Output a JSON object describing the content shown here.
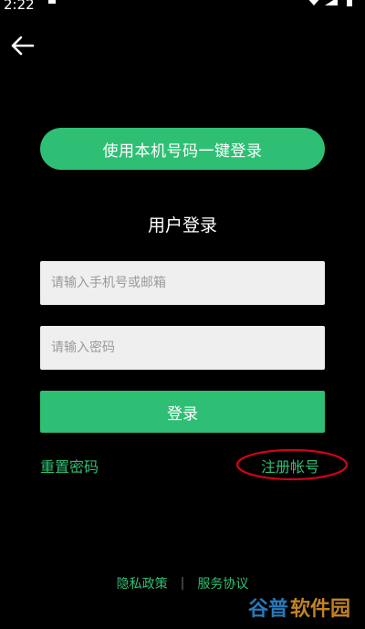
{
  "status_bar": {
    "time": "2:22"
  },
  "header": {
    "back_icon": "arrow-left-icon"
  },
  "quick_login": {
    "label": "使用本机号码一键登录"
  },
  "form": {
    "title": "用户登录",
    "phone_placeholder": "请输入手机号或邮箱",
    "password_placeholder": "请输入密码",
    "login_label": "登录",
    "reset_label": "重置密码",
    "register_label": "注册帐号"
  },
  "footer": {
    "privacy_label": "隐私政策",
    "separator": "|",
    "terms_label": "服务协议"
  },
  "watermark": {
    "text": "谷普软件园"
  },
  "colors": {
    "background": "#000000",
    "accent": "#2fbf74",
    "input_bg": "#efefef",
    "annotation": "#d0021b"
  }
}
